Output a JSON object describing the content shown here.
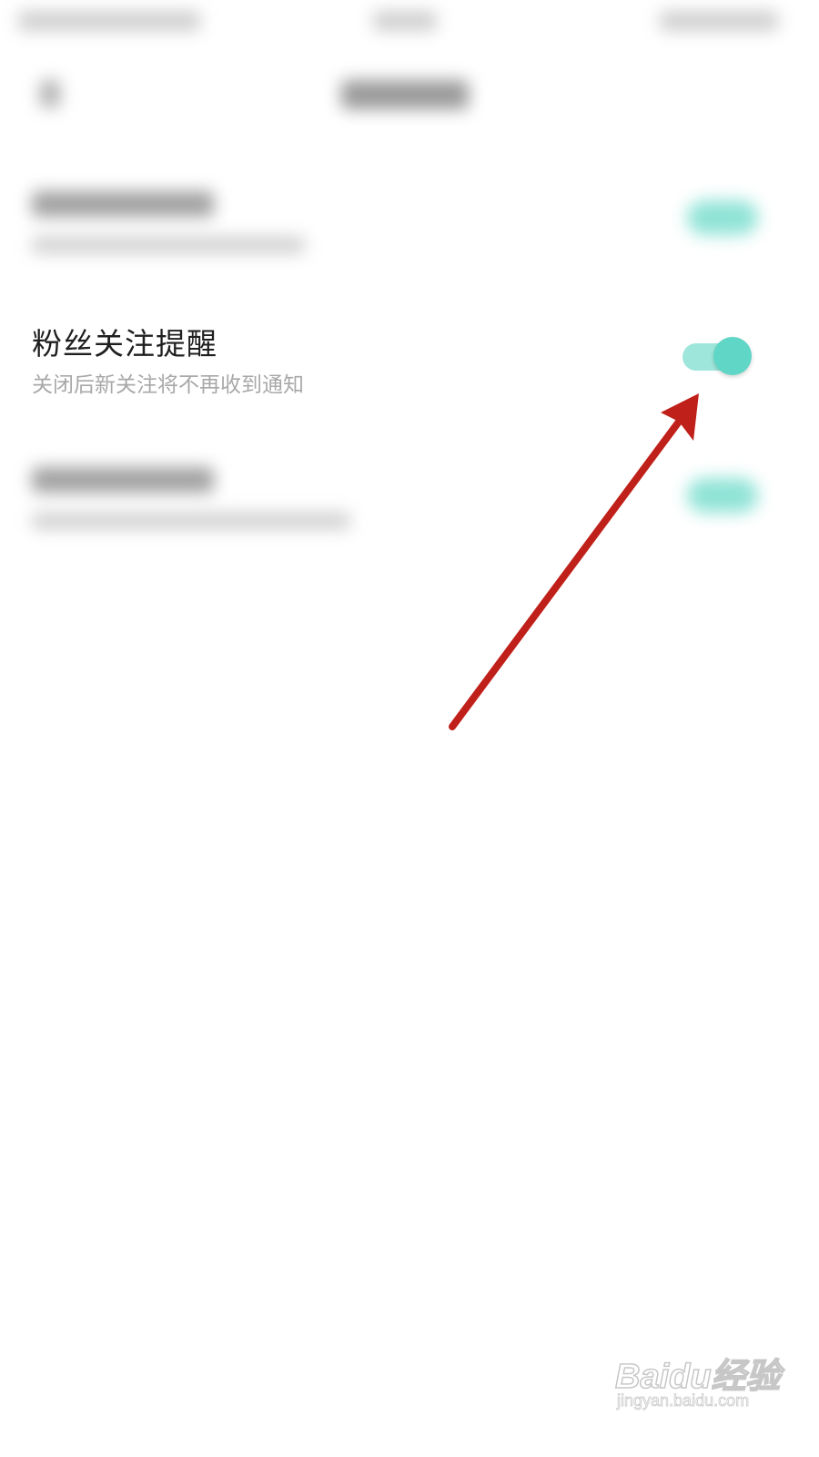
{
  "setting": {
    "title": "粉丝关注提醒",
    "description": "关闭后新关注将不再收到通知",
    "toggle_state": "on"
  },
  "colors": {
    "accent": "#5fd6c6",
    "toggle_track": "#9ee6db",
    "annotation_arrow": "#c0201a"
  },
  "watermark": {
    "main": "Baidu经验",
    "sub": "jingyan.baidu.com"
  }
}
